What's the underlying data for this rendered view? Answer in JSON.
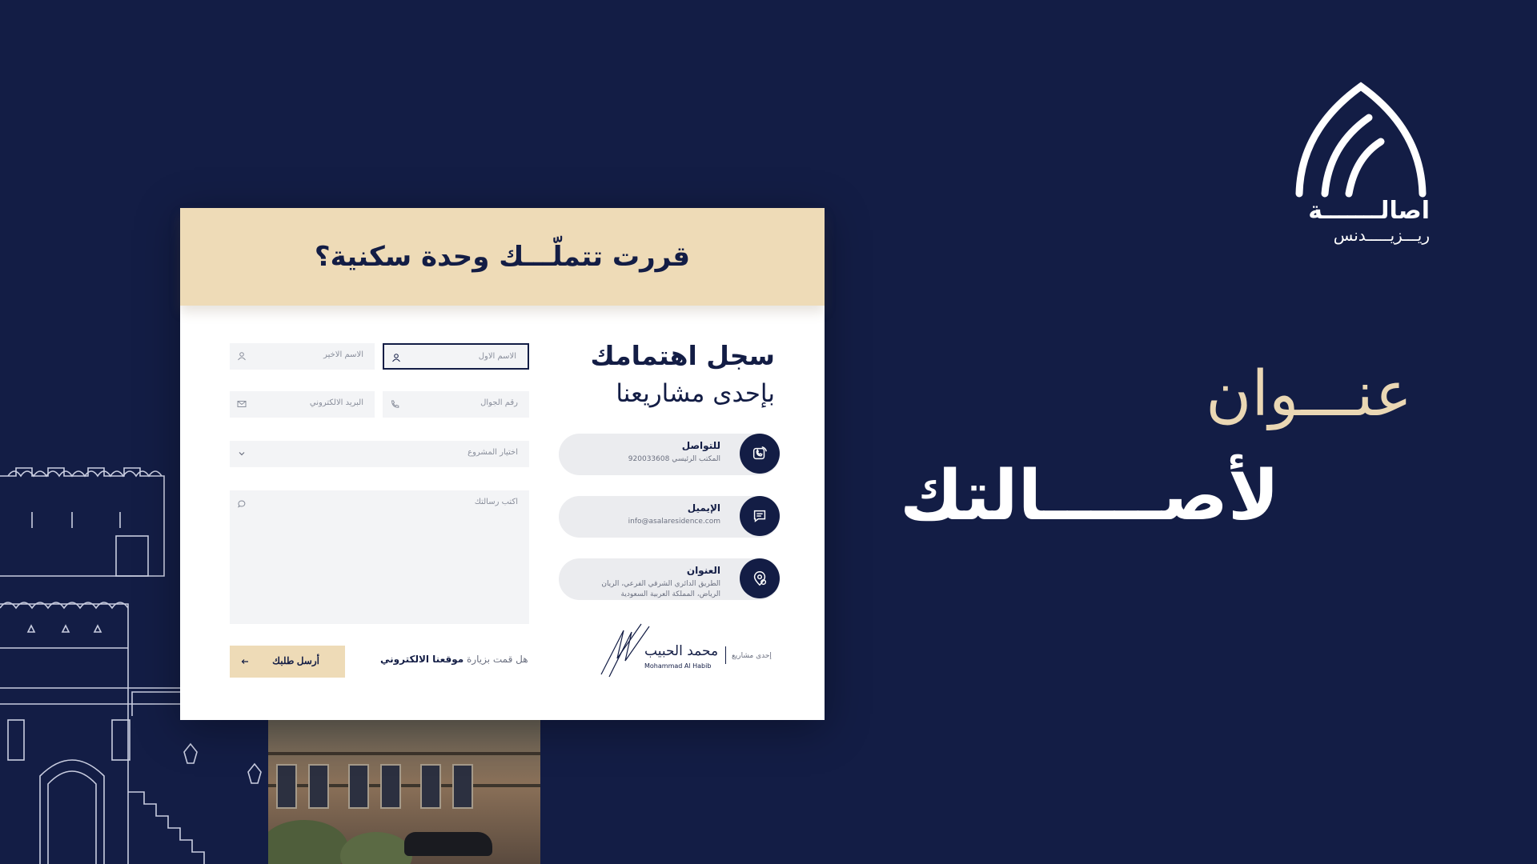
{
  "brand": {
    "logo_name": "اصالـــــــة",
    "logo_sub": "ريـــزيـــــدنس"
  },
  "headline": {
    "line1": "عنـــوان",
    "line2": "لأصـــــالتك"
  },
  "card": {
    "title": "قررت تتملّـــك وحدة سكنية؟",
    "info": {
      "heading1": "سجل اهتمامك",
      "heading2": "بإحدى مشاريعنا",
      "contacts": [
        {
          "title": "للتواصل",
          "text": "المكتب الرئيسي 920033608",
          "icon": "phone-icon"
        },
        {
          "title": "الإيميل",
          "text": "info@asalaresidence.com",
          "icon": "chat-icon"
        },
        {
          "title": "العنوان",
          "text": "الطريق الدائري الشرقي الفرعي، الريان",
          "text2": "الرياض، المملكة العربية السعودية",
          "icon": "location-icon"
        }
      ],
      "signature": {
        "label": "إحدى مشاريع",
        "name_ar": "محمد الحبيب",
        "name_en": "Mohammad Al Habib"
      }
    },
    "form": {
      "first_name_placeholder": "الاسم الاول",
      "last_name_placeholder": "الاسم الاخير",
      "phone_placeholder": "رقم الجوال",
      "email_placeholder": "البريد الالكتروني",
      "project_placeholder": "اختيار المشروع",
      "message_placeholder": "اكتب رسالتك",
      "submit_label": "أرسل طلبك",
      "visit_prefix": "هل قمت بزيارة",
      "visit_link": "موقعنا الالكتروني"
    }
  },
  "colors": {
    "background": "#131d45",
    "accent_beige": "#eedbb7",
    "headline_beige": "#ead7b4"
  }
}
